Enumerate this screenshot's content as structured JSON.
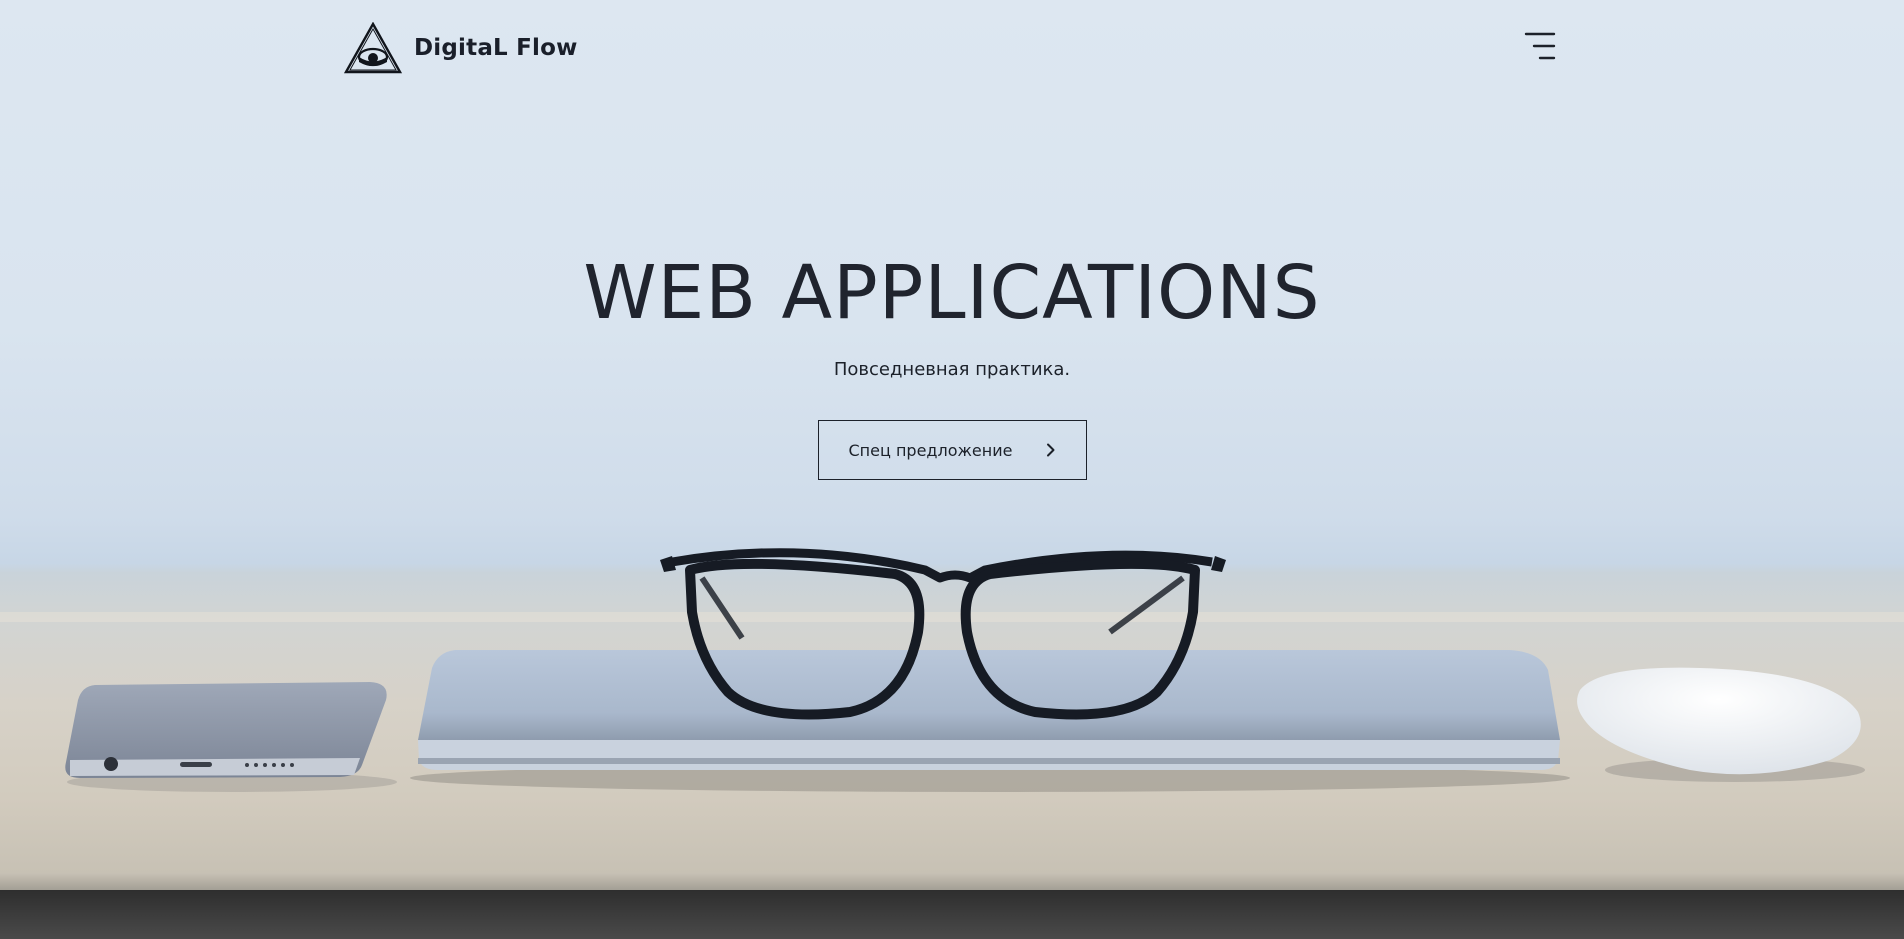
{
  "header": {
    "brand": "DigitaL Flow",
    "logo_icon": "triangle-eye-logo",
    "menu_icon": "hamburger-menu-icon"
  },
  "hero": {
    "title": "WEB APPLICATIONS",
    "subtitle": "Повседневная практика.",
    "cta_label": "Спец предложение",
    "cta_icon": "chevron-right-icon"
  },
  "colors": {
    "text": "#1c212a",
    "background": "#dde7f1",
    "desk": "#d7d2c8"
  }
}
